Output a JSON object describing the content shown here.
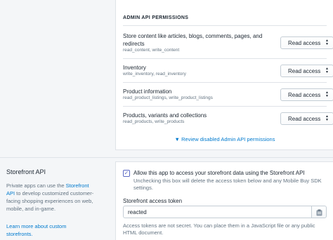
{
  "admin_api": {
    "section_title": "ADMIN API PERMISSIONS",
    "permissions": [
      {
        "name": "Store content like articles, blogs, comments, pages, and redirects",
        "scopes": "read_content, write_content",
        "access": "Read access"
      },
      {
        "name": "Inventory",
        "scopes": "write_inventory, read_inventory",
        "access": "Read access"
      },
      {
        "name": "Product information",
        "scopes": "read_product_listings, write_product_listings",
        "access": "Read access"
      },
      {
        "name": "Products, variants and collections",
        "scopes": "read_products, write_products",
        "access": "Read access"
      }
    ],
    "review_link": "Review disabled Admin API permissions"
  },
  "storefront": {
    "title": "Storefront API",
    "desc_before": "Private apps can use the ",
    "desc_link": "Storefront API",
    "desc_after": " to develop customized customer-facing shopping experiences on web, mobile, and in-game.",
    "learn_more": "Learn more about custom storefronts.",
    "checkbox_label": "Allow this app to access your storefront data using the Storefront API",
    "checkbox_help": "Unchecking this box will delete the access token below and any Mobile Buy SDK settings.",
    "token_label": "Storefront access token",
    "token_value": "reacted",
    "token_help": "Access tokens are not secret. You can place them in a JavaScript file or any public HTML document."
  },
  "colors": {
    "link": "#007ace",
    "border": "#dfe3e8",
    "subdued": "#637381",
    "accent": "#5c6ac4"
  }
}
